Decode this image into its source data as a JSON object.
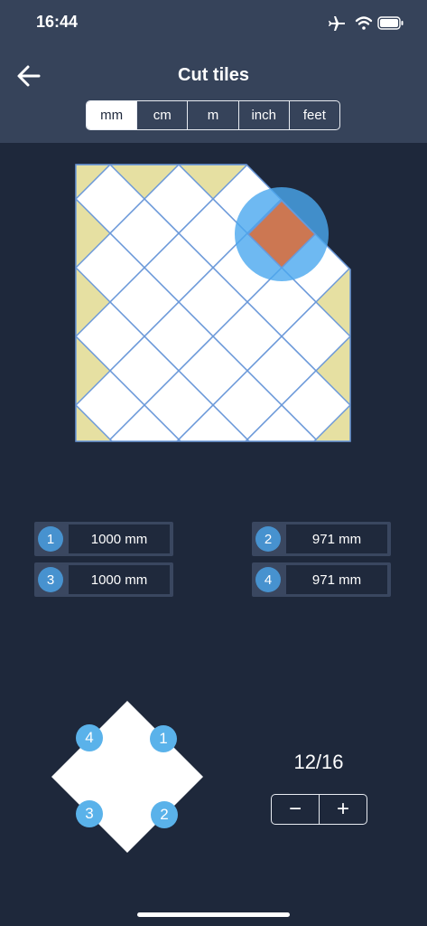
{
  "status": {
    "time": "16:44",
    "icons": [
      "airplane-icon",
      "wifi-icon",
      "battery-icon"
    ]
  },
  "header": {
    "title": "Cut tiles",
    "back_icon": "arrow-left-icon"
  },
  "units": {
    "options": [
      "mm",
      "cm",
      "m",
      "inch",
      "feet"
    ],
    "selected": "mm"
  },
  "measurements": [
    {
      "badge": "1",
      "value": "1000 mm"
    },
    {
      "badge": "2",
      "value": "971 mm"
    },
    {
      "badge": "3",
      "value": "1000 mm"
    },
    {
      "badge": "4",
      "value": "971 mm"
    }
  ],
  "tile": {
    "corners": [
      "4",
      "1",
      "3",
      "2"
    ]
  },
  "counter": {
    "text": "12/16"
  },
  "stepper": {
    "minus": "−",
    "plus": "+"
  },
  "colors": {
    "background": "#1e283b",
    "header": "#36435a",
    "tile_fill": "#ffffff",
    "cut_tile_fill": "#e6e0a2",
    "grout_line": "#6a98d9",
    "highlight_tile": "#cc7752",
    "highlight_circle": "#4aa8ef",
    "badge": "#4792cf"
  }
}
